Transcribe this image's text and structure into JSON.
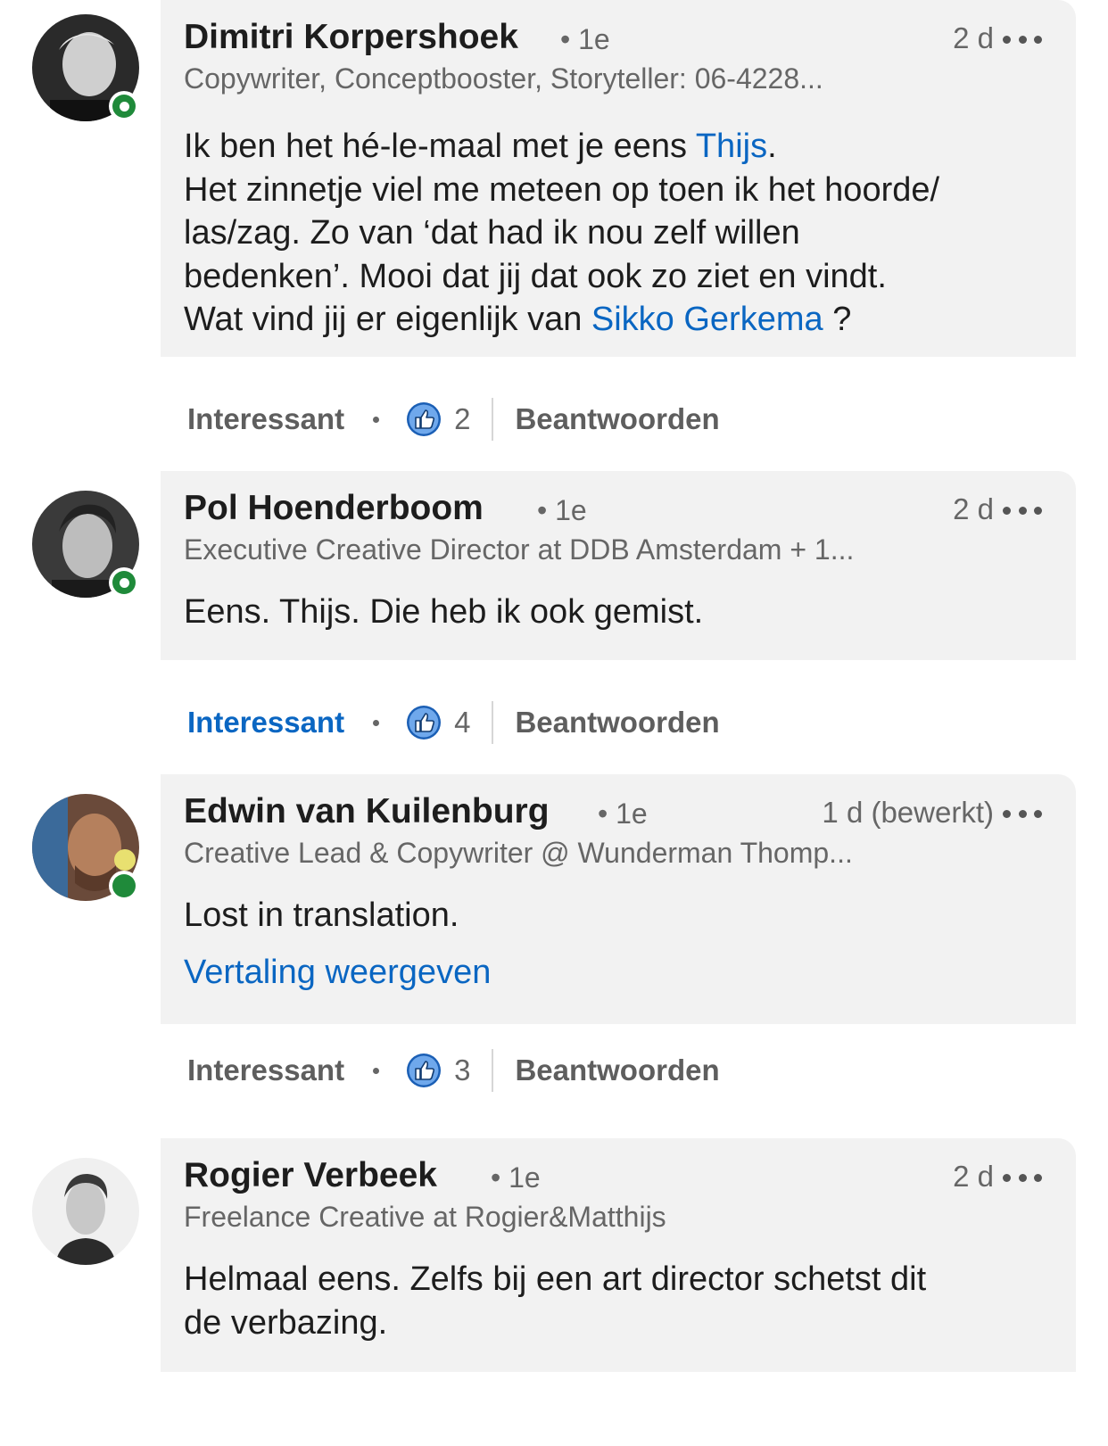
{
  "comments": [
    {
      "name": "Dimitri Korpershoek",
      "degree": "• 1e",
      "time": "2 d",
      "headline": "Copywriter, Conceptbooster, Storyteller: 06-4228...",
      "text_parts": {
        "l1a": "Ik ben het hé-le-maal met je eens ",
        "l1link": "Thijs",
        "l1b": ".",
        "l2": "Het zinnetje viel me meteen op toen ik het hoorde/",
        "l3": "las/zag. Zo van ‘dat had ik nou zelf willen",
        "l4": "bedenken’. Mooi dat jij dat ook zo ziet en vindt.",
        "l5a": "Wat vind jij er eigenlijk van ",
        "l5link": "Sikko Gerkema",
        "l5b": " ?"
      },
      "like_label": "Interessant",
      "reaction_count": "2",
      "reply_label": "Beantwoorden"
    },
    {
      "name": "Pol Hoenderboom",
      "degree": "• 1e",
      "time": "2 d",
      "headline": "Executive Creative Director at DDB Amsterdam + 1...",
      "text": "Eens. Thijs. Die heb ik ook gemist.",
      "like_label": "Interessant",
      "reaction_count": "4",
      "reply_label": "Beantwoorden"
    },
    {
      "name": "Edwin van Kuilenburg",
      "degree": "• 1e",
      "time": "1 d (bewerkt)",
      "headline": "Creative Lead & Copywriter @ Wunderman Thomp...",
      "text": "Lost in translation.",
      "translate": "Vertaling weergeven",
      "like_label": "Interessant",
      "reaction_count": "3",
      "reply_label": "Beantwoorden"
    },
    {
      "name": "Rogier Verbeek",
      "degree": "• 1e",
      "time": "2 d",
      "headline": "Freelance Creative at Rogier&Matthijs",
      "text_l1": "Helmaal eens. Zelfs bij een art director schetst dit",
      "text_l2": "de verbazing."
    }
  ],
  "colors": {
    "link": "#0a66c2",
    "online": "#1f8a3a",
    "bubble": "#f2f2f2"
  }
}
